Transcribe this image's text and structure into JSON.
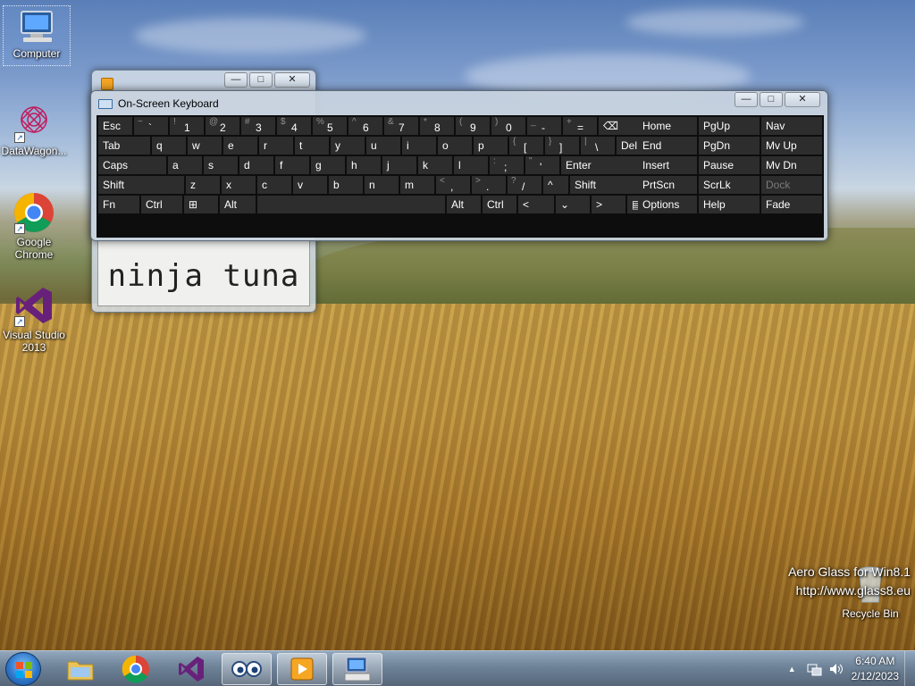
{
  "desktop": {
    "icons": [
      {
        "label": "Computer"
      },
      {
        "label": "DataWagon..."
      },
      {
        "label": "Google Chrome"
      },
      {
        "label": "Visual Studio 2013"
      },
      {
        "label": "Recycle Bin"
      }
    ],
    "watermark": {
      "line1": "Aero Glass for Win8.1",
      "line2": "http://www.glass8.eu"
    }
  },
  "background_window": {
    "content_text": "ninja tuna",
    "minimize": "—",
    "maximize": "□",
    "close": "✕"
  },
  "osk": {
    "title": "On-Screen Keyboard",
    "minimize": "—",
    "maximize": "□",
    "close": "✕",
    "rows": [
      [
        {
          "l": "Esc"
        },
        {
          "s": "~",
          "l": "`"
        },
        {
          "s": "!",
          "l": "1"
        },
        {
          "s": "@",
          "l": "2"
        },
        {
          "s": "#",
          "l": "3"
        },
        {
          "s": "$",
          "l": "4"
        },
        {
          "s": "%",
          "l": "5"
        },
        {
          "s": "^",
          "l": "6"
        },
        {
          "s": "&",
          "l": "7"
        },
        {
          "s": "*",
          "l": "8"
        },
        {
          "s": "(",
          "l": "9"
        },
        {
          "s": ")",
          "l": "0"
        },
        {
          "s": "_",
          "l": "-"
        },
        {
          "s": "+",
          "l": "="
        },
        {
          "l": "⌫"
        }
      ],
      [
        {
          "l": "Tab"
        },
        {
          "l": "q"
        },
        {
          "l": "w"
        },
        {
          "l": "e"
        },
        {
          "l": "r"
        },
        {
          "l": "t"
        },
        {
          "l": "y"
        },
        {
          "l": "u"
        },
        {
          "l": "i"
        },
        {
          "l": "o"
        },
        {
          "l": "p"
        },
        {
          "s": "{",
          "l": "["
        },
        {
          "s": "}",
          "l": "]"
        },
        {
          "s": "|",
          "l": "\\"
        },
        {
          "l": "Del"
        }
      ],
      [
        {
          "l": "Caps"
        },
        {
          "l": "a"
        },
        {
          "l": "s"
        },
        {
          "l": "d"
        },
        {
          "l": "f"
        },
        {
          "l": "g"
        },
        {
          "l": "h"
        },
        {
          "l": "j"
        },
        {
          "l": "k"
        },
        {
          "l": "l"
        },
        {
          "s": ":",
          "l": ";"
        },
        {
          "s": "\"",
          "l": "'"
        },
        {
          "l": "Enter"
        }
      ],
      [
        {
          "l": "Shift"
        },
        {
          "l": "z"
        },
        {
          "l": "x"
        },
        {
          "l": "c"
        },
        {
          "l": "v"
        },
        {
          "l": "b"
        },
        {
          "l": "n"
        },
        {
          "l": "m"
        },
        {
          "s": "<",
          "l": ","
        },
        {
          "s": ">",
          "l": "."
        },
        {
          "s": "?",
          "l": "/"
        },
        {
          "l": "^"
        },
        {
          "l": "Shift"
        }
      ],
      [
        {
          "l": "Fn"
        },
        {
          "l": "Ctrl"
        },
        {
          "l": "⊞"
        },
        {
          "l": "Alt"
        },
        {
          "l": ""
        },
        {
          "l": "Alt"
        },
        {
          "l": "Ctrl"
        },
        {
          "l": "<"
        },
        {
          "l": "⌄"
        },
        {
          "l": ">"
        },
        {
          "l": "▤"
        }
      ]
    ],
    "nav_rows": [
      [
        "Home",
        "PgUp",
        "Nav"
      ],
      [
        "End",
        "PgDn",
        "Mv Up"
      ],
      [
        "Insert",
        "Pause",
        "Mv Dn"
      ],
      [
        "PrtScn",
        "ScrLk",
        "Dock"
      ],
      [
        "Options",
        "Help",
        "Fade"
      ]
    ],
    "disabled_key": "Dock"
  },
  "taskbar": {
    "pinned": [
      "File Explorer",
      "Google Chrome",
      "Visual Studio",
      "Eyes app",
      "Media app",
      "On-Screen Keyboard"
    ],
    "clock_time": "6:40 AM",
    "clock_date": "2/12/2023",
    "tray_chevron": "▲"
  }
}
